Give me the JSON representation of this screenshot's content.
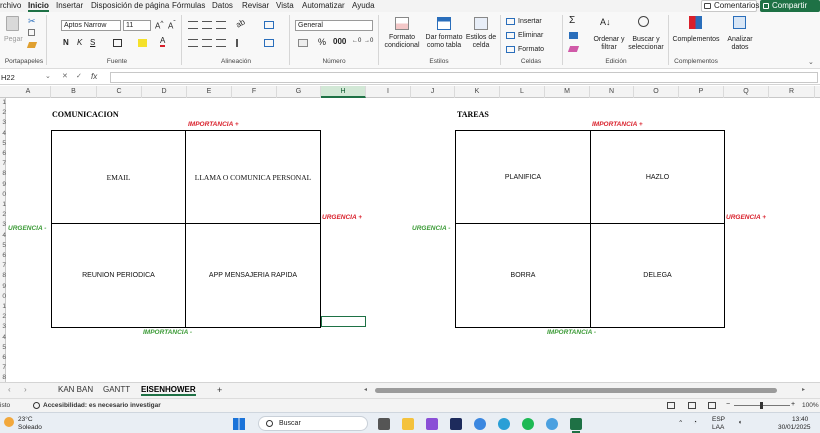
{
  "menu": {
    "items": [
      "rchivo",
      "Inicio",
      "Insertar",
      "Disposición de página",
      "Fórmulas",
      "Datos",
      "Revisar",
      "Vista",
      "Automatizar",
      "Ayuda"
    ],
    "comments": "Comentarios",
    "share": "Compartir"
  },
  "ribbon": {
    "clipboard": {
      "paste": "Pegar",
      "label": "Portapapeles"
    },
    "font": {
      "name": "Aptos Narrow",
      "size": "11",
      "label": "Fuente"
    },
    "alignment": {
      "label": "Alineación"
    },
    "number": {
      "format": "General",
      "label": "Número"
    },
    "styles": {
      "conditional": "Formato condicional",
      "table": "Dar formato como tabla",
      "cell": "Estilos de celda",
      "label": "Estilos"
    },
    "cells": {
      "insert": "Insertar",
      "delete": "Eliminar",
      "format": "Formato",
      "label": "Celdas"
    },
    "editing": {
      "sort": "Ordenar y filtrar",
      "find": "Buscar y seleccionar",
      "label": "Edición"
    },
    "addins": {
      "addins": "Complementos",
      "analyze": "Analizar datos",
      "label": "Complementos"
    }
  },
  "formula_bar": {
    "name_box": "H22",
    "fx": "fx",
    "value": ""
  },
  "columns": [
    "A",
    "B",
    "C",
    "D",
    "E",
    "F",
    "G",
    "H",
    "I",
    "J",
    "K",
    "L",
    "M",
    "N",
    "O",
    "P",
    "Q",
    "R"
  ],
  "selected_column": "H",
  "matrix_left": {
    "title": "COMUNICACION",
    "top_label": "IMPORTANCIA +",
    "bottom_label": "IMPORTANCIA -",
    "left_label": "URGENCIA -",
    "right_label": "URGENCIA +",
    "q1": "EMAIL",
    "q2": "LLAMA O COMUNICA PERSONAL",
    "q3": "REUNION PERIODICA",
    "q4": "APP MENSAJERIA RAPIDA"
  },
  "matrix_right": {
    "title": "TAREAS",
    "top_label": "IMPORTANCIA +",
    "bottom_label": "IMPORTANCIA -",
    "left_label": "URGENCIA -",
    "right_label": "URGENCIA +",
    "q1": "PLANIFICA",
    "q2": "HAZLO",
    "q3": "BORRA",
    "q4": "DELEGA"
  },
  "sheets": [
    "KAN BAN",
    "GANTT",
    "EISENHOWER"
  ],
  "active_sheet": "EISENHOWER",
  "add_sheet": "+",
  "status": {
    "mode": "isto",
    "accessibility": "Accesibilidad: es necesario investigar",
    "zoom": "100%"
  },
  "taskbar": {
    "weather_temp": "23°C",
    "weather_desc": "Soleado",
    "search": "Buscar",
    "lang1": "ESP",
    "lang2": "LAA",
    "time": "13:40",
    "date": "30/01/2025"
  },
  "colors": {
    "accent": "#1e7145",
    "importance": "#d9202b",
    "urgency": "#3a9a35"
  }
}
